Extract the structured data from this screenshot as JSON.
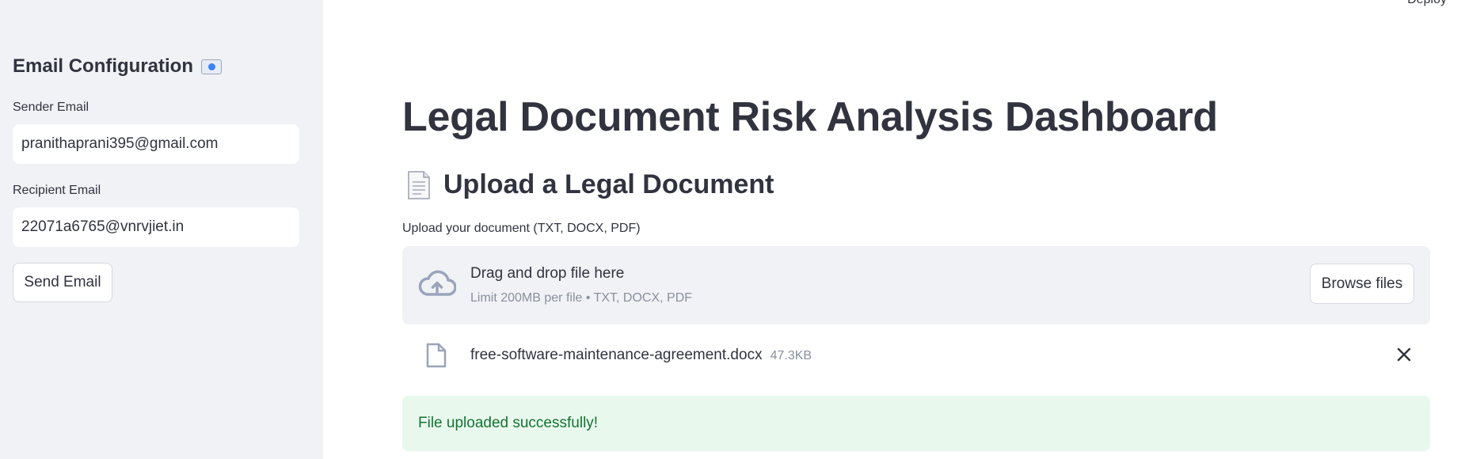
{
  "header": {
    "deploy_label": "Deploy"
  },
  "sidebar": {
    "heading": "Email Configuration",
    "heading_icon": "envelope-icon",
    "sender_label": "Sender Email",
    "sender_value": "pranithaprani395@gmail.com",
    "recipient_label": "Recipient Email",
    "recipient_value": "22071a6765@vnrvjiet.in",
    "send_button": "Send Email"
  },
  "main": {
    "title": "Legal Document Risk Analysis Dashboard",
    "subheader": "Upload a Legal Document",
    "subheader_icon": "document-icon",
    "uploader": {
      "label": "Upload your document (TXT, DOCX, PDF)",
      "drop_text": "Drag and drop file here",
      "limit_text": "Limit 200MB per file • TXT, DOCX, PDF",
      "browse_button": "Browse files"
    },
    "file": {
      "name": "free-software-maintenance-agreement.docx",
      "size": "47.3KB"
    },
    "success_message": "File uploaded successfully!"
  },
  "colors": {
    "sidebar_bg": "#f0f2f6",
    "text": "#31333f",
    "success_bg": "#e8f8ed",
    "success_text": "#177233"
  }
}
